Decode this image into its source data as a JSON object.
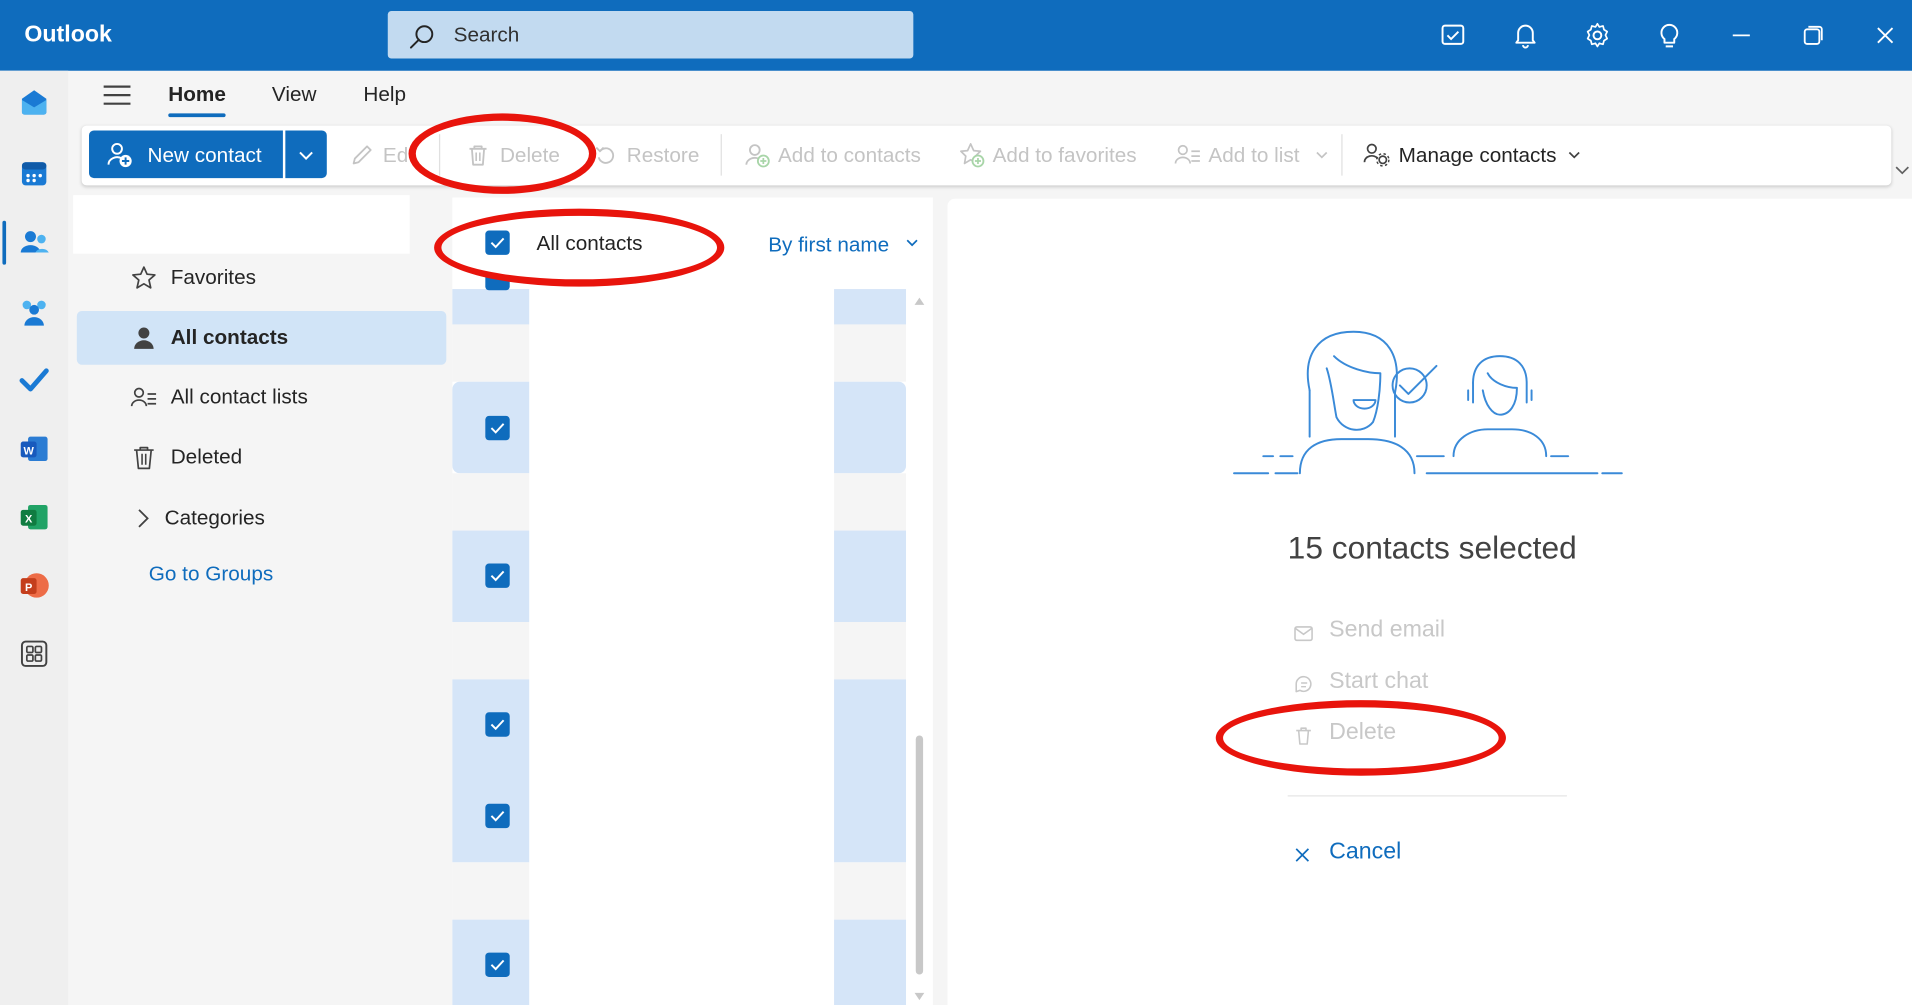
{
  "app": {
    "title": "Outlook"
  },
  "search": {
    "placeholder": "Search"
  },
  "titlebar_icons": [
    "my-day-icon",
    "bell-icon",
    "gear-icon",
    "lightbulb-icon",
    "minimize-icon",
    "restore-icon",
    "close-icon"
  ],
  "rail": [
    "mail-icon",
    "calendar-icon",
    "people-icon",
    "groups-icon",
    "todo-icon",
    "word-icon",
    "excel-icon",
    "powerpoint-icon",
    "apps-icon"
  ],
  "tabs": [
    {
      "label": "Home",
      "active": true
    },
    {
      "label": "View",
      "active": false
    },
    {
      "label": "Help",
      "active": false
    }
  ],
  "ribbon": {
    "new_contact": "New contact",
    "edit": "Ed",
    "delete": "Delete",
    "restore": "Restore",
    "add_to_contacts": "Add to contacts",
    "add_to_favorites": "Add to favorites",
    "add_to_list": "Add to list",
    "manage_contacts": "Manage contacts"
  },
  "folders": {
    "items": [
      {
        "label": "Favorites",
        "icon": "star-icon",
        "selected": false
      },
      {
        "label": "All contacts",
        "icon": "person-icon",
        "selected": true
      },
      {
        "label": "All contact lists",
        "icon": "contact-list-icon",
        "selected": false
      },
      {
        "label": "Deleted",
        "icon": "trash-icon",
        "selected": false
      },
      {
        "label": "Categories",
        "icon": "chevron-right-icon",
        "selected": false
      }
    ],
    "go_to_groups": "Go to Groups"
  },
  "list": {
    "header": "All contacts",
    "sort": "By first name",
    "all_checked": true
  },
  "reading": {
    "selected_count": "15 contacts selected",
    "actions": {
      "send_email": "Send email",
      "start_chat": "Start chat",
      "delete": "Delete",
      "cancel": "Cancel"
    }
  },
  "colors": {
    "brand": "#0f6cbd",
    "annotation": "#e8140c",
    "selection": "#d1e4f7"
  }
}
